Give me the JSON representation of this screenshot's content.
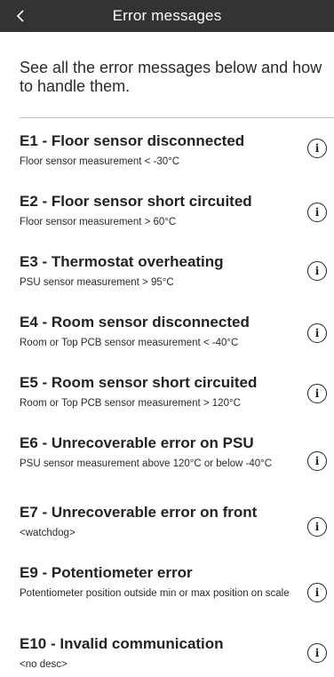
{
  "header": {
    "title": "Error messages",
    "back_icon": "chevron-left-icon"
  },
  "intro": "See all the error messages below and how to handle them.",
  "errors": [
    {
      "title": "E1 - Floor sensor disconnected",
      "desc": "Floor sensor measurement < -30°C"
    },
    {
      "title": "E2 - Floor sensor short circuited",
      "desc": "Floor sensor measurement > 60°C"
    },
    {
      "title": "E3 - Thermostat overheating",
      "desc": "PSU sensor measurement > 95°C"
    },
    {
      "title": "E4 - Room sensor disconnected",
      "desc": "Room or Top PCB sensor measurement < -40°C"
    },
    {
      "title": "E5 - Room sensor short circuited",
      "desc": "Room or Top PCB sensor measurement > 120°C"
    },
    {
      "title": "E6 - Unrecoverable error on PSU",
      "desc": "PSU sensor measurement above 120°C or below -40°C"
    },
    {
      "title": "E7 - Unrecoverable error on front",
      "desc": "<watchdog>"
    },
    {
      "title": "E9 - Potentiometer error",
      "desc": "Potentiometer position outside min or max position on scale"
    },
    {
      "title": "E10 - Invalid communication",
      "desc": "<no desc>"
    }
  ],
  "info_icon": "info-icon",
  "info_glyph": "i",
  "colors": {
    "header_bg": "#333333",
    "header_text": "#ffffff",
    "text": "#222222",
    "divider": "#bdbdbd"
  }
}
